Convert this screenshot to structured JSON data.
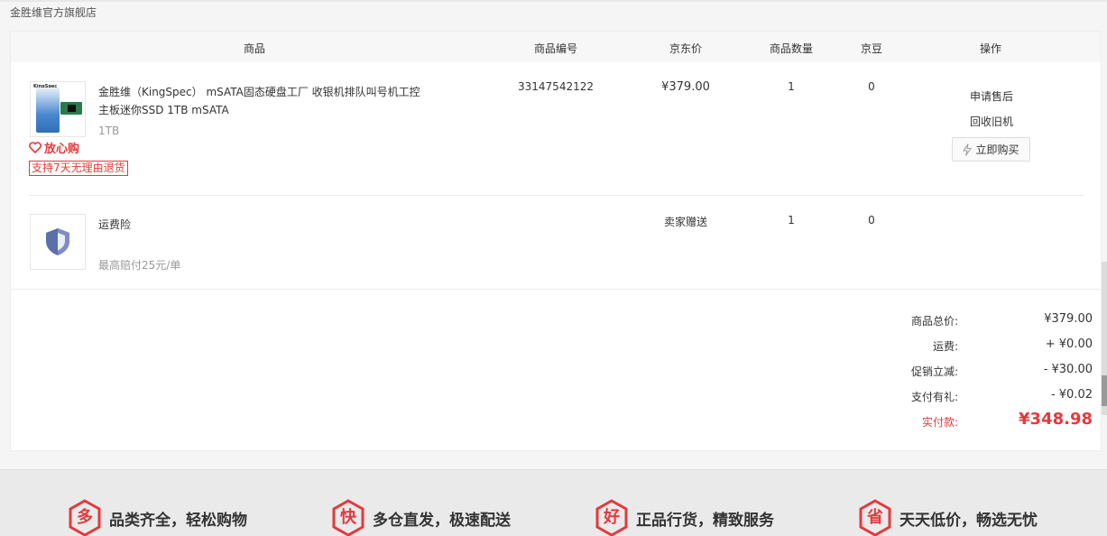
{
  "shop": {
    "name": "金胜维官方旗舰店"
  },
  "table": {
    "headers": {
      "product": "商品",
      "product_no": "商品编号",
      "jd_price": "京东价",
      "quantity": "商品数量",
      "jingdou": "京豆",
      "operation": "操作"
    }
  },
  "items": [
    {
      "title": "金胜维（KingSpec） mSATA固态硬盘工厂 收银机排队叫号机工控主板迷你SSD 1TB mSATA",
      "spec": "1TB",
      "image_brand": "KingSpec",
      "badge": "放心购",
      "return_policy": "支持7天无理由退货",
      "product_no": "33147542122",
      "price": "¥379.00",
      "quantity": "1",
      "jingdou": "0",
      "actions": {
        "after_sale": "申请售后",
        "recycle": "回收旧机",
        "buy_again": "立即购买"
      }
    },
    {
      "title": "运费险",
      "subtitle": "最高赔付25元/单",
      "price": "卖家赠送",
      "quantity": "1",
      "jingdou": "0",
      "icon": "shield-icon"
    }
  ],
  "summary": {
    "total_label": "商品总价:",
    "total_value": "¥379.00",
    "shipping_label": "运费:",
    "shipping_value": "+ ¥0.00",
    "promo_label": "促销立减:",
    "promo_value": "- ¥30.00",
    "gift_label": "支付有礼:",
    "gift_value": "- ¥0.02",
    "paid_label": "实付款:",
    "paid_value": "¥348.98"
  },
  "footer": {
    "promises": [
      {
        "icon_char": "多",
        "text": "品类齐全，轻松购物"
      },
      {
        "icon_char": "快",
        "text": "多仓直发，极速配送"
      },
      {
        "icon_char": "好",
        "text": "正品行货，精致服务"
      },
      {
        "icon_char": "省",
        "text": "天天低价，畅选无忧"
      }
    ]
  },
  "colors": {
    "accent_red": "#e4393c",
    "shield_blue": "#5b6fa8"
  }
}
